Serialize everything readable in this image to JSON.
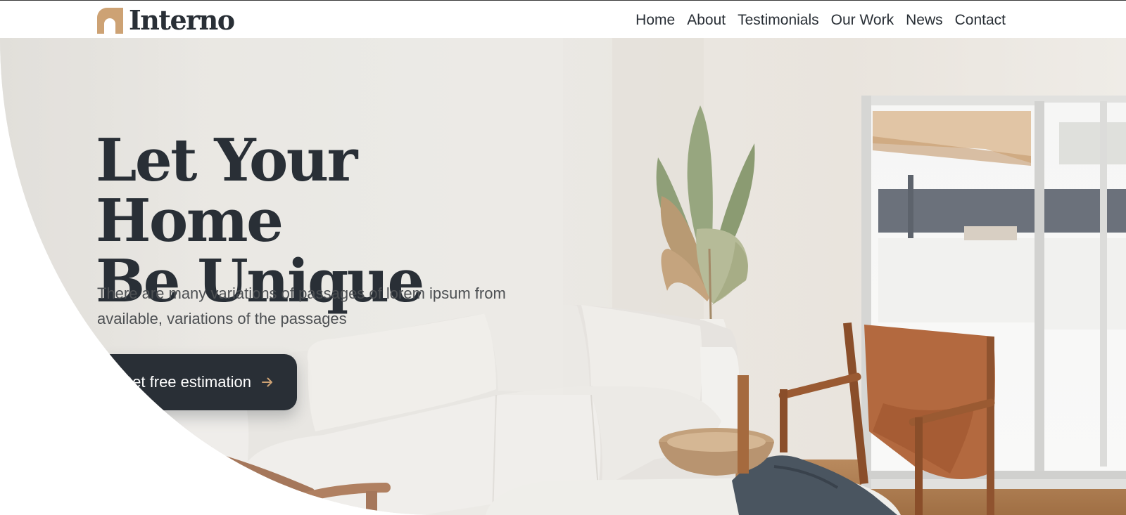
{
  "brand": {
    "name": "Interno",
    "logo_icon": "arch-icon",
    "accent_color": "#cda274"
  },
  "nav": {
    "items": [
      "Home",
      "About",
      "Testimonials",
      "Our Work",
      "News",
      "Contact"
    ]
  },
  "hero": {
    "headline_line1": "Let Your Home",
    "headline_line2": "Be Unique",
    "description": "There are many variations of passages of lorem ipsum from available, variations of the passages",
    "cta_label": "Get free estimation",
    "cta_icon": "arrow-right-icon",
    "image_subject": "living-room-photo"
  },
  "colors": {
    "primary_dark": "#292f36",
    "text_muted": "#4d5053",
    "accent": "#cda274"
  }
}
